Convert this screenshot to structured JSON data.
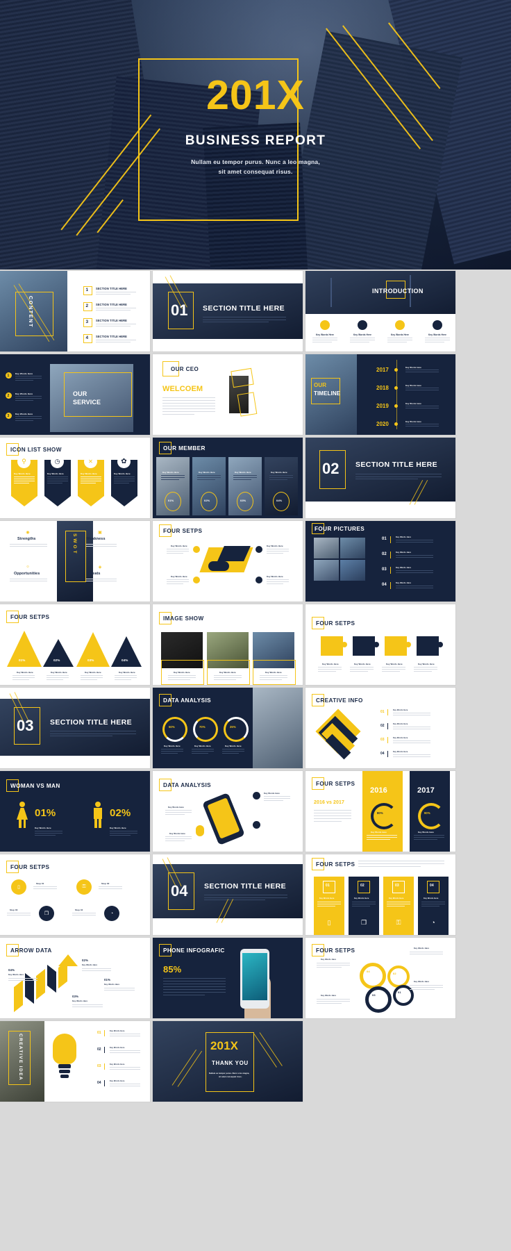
{
  "accent": {
    "yellow": "#f5c518",
    "navy": "#16233d",
    "white": "#ffffff",
    "muted": "#8d93a0"
  },
  "hero": {
    "year": "201X",
    "title": "BUSINESS REPORT",
    "desc_line1": "Nullam eu tempor purus. Nunc a leo magna,",
    "desc_line2": "sit amet consequat risus."
  },
  "common": {
    "key_words": "Key Words Here",
    "lorem_short": "Lorem ipsum dolor sit amet, consectetur adipiscing elit. Integer mollis vehicula ligula ut faucibus.",
    "lorem_long": "Lorem ipsum dolor sit amet, consectetur adipiscing elit. Integer mollis vehicula ligula ut faucibus. Curabitur vestibulum consequat urna ut vehicula. Suspendisse feugiat bibendum dolor agestas.",
    "section_title": "SECTION TITLE HERE"
  },
  "slides": [
    {
      "id": "content",
      "title": "CONTENT",
      "items": [
        {
          "num": "1",
          "label": "SECTION TITLE HERE"
        },
        {
          "num": "2",
          "label": "SECTION TITLE HERE"
        },
        {
          "num": "3",
          "label": "SECTION TITLE HERE"
        },
        {
          "num": "4",
          "label": "SECTION TITLE HERE"
        }
      ]
    },
    {
      "id": "section-01",
      "number": "01",
      "title": "SECTION TITLE HERE"
    },
    {
      "id": "introduction",
      "title": "INTRODUCTION",
      "cards": [
        {
          "label": "Key Words Here"
        },
        {
          "label": "Key Words Here"
        },
        {
          "label": "Key Words Here"
        },
        {
          "label": "Key Words Here"
        }
      ]
    },
    {
      "id": "our-service",
      "title_line1": "OUR",
      "title_line2": "SERVICE",
      "items": [
        {
          "num": "1",
          "label": "Key Words Here"
        },
        {
          "num": "2",
          "label": "Key Words Here"
        },
        {
          "num": "3",
          "label": "Key Words Here"
        }
      ]
    },
    {
      "id": "our-ceo",
      "title": "OUR CEO",
      "welcome": "WELCOEM"
    },
    {
      "id": "our-timeline",
      "title_line1": "OUR",
      "title_line2": "TIMELINE",
      "years": [
        "2017",
        "2018",
        "2019",
        "2020"
      ]
    },
    {
      "id": "icon-list-show",
      "title": "ICON LIST SHOW",
      "icons": [
        "location-icon",
        "clock-icon",
        "tools-icon",
        "gear-icon"
      ]
    },
    {
      "id": "our-member",
      "title": "OUR MEMBER",
      "members": [
        {
          "label": "Key Words Here",
          "percent": "01%"
        },
        {
          "label": "Key Words Here",
          "percent": "02%"
        },
        {
          "label": "Key Words Here",
          "percent": "03%"
        },
        {
          "label": "Key Words Here",
          "percent": "04%"
        }
      ]
    },
    {
      "id": "section-02",
      "number": "02",
      "title": "SECTION TITLE HERE"
    },
    {
      "id": "swot",
      "center": "SWOT",
      "quadrants": [
        {
          "label": "Strengths"
        },
        {
          "label": "Weakness"
        },
        {
          "label": "Opportunities"
        },
        {
          "label": "Threats"
        }
      ]
    },
    {
      "id": "four-setps-handshake",
      "title": "FOUR SETPS",
      "items": [
        {
          "label": "Key Words Here"
        },
        {
          "label": "Key Words Here"
        },
        {
          "label": "Key Words Here"
        },
        {
          "label": "Key Words Here"
        }
      ]
    },
    {
      "id": "four-pictures",
      "title": "FOUR PICTURES",
      "items": [
        {
          "num": "01",
          "label": "Key Words Here"
        },
        {
          "num": "02",
          "label": "Key Words Here"
        },
        {
          "num": "03",
          "label": "Key Words Here"
        },
        {
          "num": "04",
          "label": "Key Words Here"
        }
      ]
    },
    {
      "id": "four-setps-cones",
      "title": "FOUR SETPS",
      "items": [
        {
          "percent": "01%",
          "label": "Key Words Here"
        },
        {
          "percent": "02%",
          "label": "Key Words Here"
        },
        {
          "percent": "03%",
          "label": "Key Words Here"
        },
        {
          "percent": "04%",
          "label": "Key Words Here"
        }
      ]
    },
    {
      "id": "image-show",
      "title": "IMAGE SHOW",
      "items": [
        {
          "label": "Key Words Here"
        },
        {
          "label": "Key Words Here"
        },
        {
          "label": "Key Words Here"
        }
      ]
    },
    {
      "id": "four-setps-puzzle",
      "title": "FOUR SETPS",
      "items": [
        {
          "label": "Key Words Here"
        },
        {
          "label": "Key Words Here"
        },
        {
          "label": "Key Words Here"
        },
        {
          "label": "Key Words Here"
        }
      ]
    },
    {
      "id": "section-03",
      "number": "03",
      "title": "SECTION TITLE HERE"
    },
    {
      "id": "data-analysis-rings",
      "title": "DATA ANALYSIS",
      "rings": [
        {
          "percent": "50%",
          "label": "Key Words Here"
        },
        {
          "percent": "70%",
          "label": "Key Words Here"
        },
        {
          "percent": "25%",
          "label": "Key Words Here"
        }
      ]
    },
    {
      "id": "creative-info",
      "title": "CREATIVE  INFO",
      "items": [
        {
          "num": "01",
          "label": "Key Words Here"
        },
        {
          "num": "02",
          "label": "Key Words Here"
        },
        {
          "num": "03",
          "label": "Key Words Here"
        },
        {
          "num": "04",
          "label": "Key Words Here"
        }
      ]
    },
    {
      "id": "woman-vs-man",
      "title": "WOMAN VS MAN",
      "stats": [
        {
          "percent": "01%",
          "label": "Key Words Here",
          "icon": "woman-icon"
        },
        {
          "percent": "02%",
          "label": "Key Words Here",
          "icon": "man-icon"
        }
      ]
    },
    {
      "id": "data-analysis-phone",
      "title": "DATA ANALYSIS",
      "items": [
        {
          "label": "Key Words Here"
        },
        {
          "label": "Key Words Here"
        },
        {
          "label": "Key Words Here"
        }
      ]
    },
    {
      "id": "four-setps-compare",
      "title": "FOUR SETPS",
      "compare": "2016 vs 2017",
      "columns": [
        {
          "year": "2016",
          "percent": "80%",
          "label": "Key Words Here"
        },
        {
          "year": "2017",
          "percent": "90%",
          "label": "Key Words Here"
        }
      ]
    },
    {
      "id": "four-setps-steps",
      "title": "FOUR SETPS",
      "steps": [
        {
          "step": "Step 01",
          "label": "We have many ProposPoint templates that have been specifically designed"
        },
        {
          "step": "Step 02",
          "label": "We have many ProposPoint templates that have been specifically designed"
        },
        {
          "step": "Step 03",
          "label": "We have many ProposPoint templates that have been specifically designed"
        },
        {
          "step": "Step 04",
          "label": "We have many ProposPoint templates that have been specifically designed"
        }
      ]
    },
    {
      "id": "section-04",
      "number": "04",
      "title": "SECTION TITLE HERE"
    },
    {
      "id": "four-setps-cards",
      "title": "FOUR SETPS",
      "cards": [
        {
          "num": "01",
          "label": "Key Words Here"
        },
        {
          "num": "02",
          "label": "Key Words Here"
        },
        {
          "num": "03",
          "label": "Key Words Here"
        },
        {
          "num": "04",
          "label": "Key Words Here"
        }
      ]
    },
    {
      "id": "arrow-data",
      "title": "ARROW DATA",
      "points": [
        {
          "percent": "01%",
          "label": "Key Words Here"
        },
        {
          "percent": "02%",
          "label": "Key Words Here"
        },
        {
          "percent": "03%",
          "label": "Key Words Here"
        },
        {
          "percent": "04%",
          "label": "Key Words Here"
        }
      ]
    },
    {
      "id": "phone-infografic",
      "title": "PHONE INFOGRAFIC",
      "percent": "85%"
    },
    {
      "id": "four-setps-gears",
      "title": "FOUR SETPS",
      "gears": [
        {
          "num": "01",
          "label": "Key Words Here"
        },
        {
          "num": "02",
          "label": "Key Words Here"
        },
        {
          "num": "03",
          "label": "Key Words Here"
        },
        {
          "num": "04",
          "label": "Key Words Here"
        }
      ]
    },
    {
      "id": "creative-idea",
      "title": "CREATIVE IDEA",
      "items": [
        {
          "num": "01",
          "label": "Key Words Here"
        },
        {
          "num": "02",
          "label": "Key Words Here"
        },
        {
          "num": "03",
          "label": "Key Words Here"
        },
        {
          "num": "04",
          "label": "Key Words Here"
        }
      ]
    },
    {
      "id": "thank-you",
      "year": "201X",
      "title": "THANK YOU",
      "desc_line1": "Nullam eu tempor purus. Nunc a leo magna,",
      "desc_line2": "sit amet consequat risus."
    }
  ]
}
